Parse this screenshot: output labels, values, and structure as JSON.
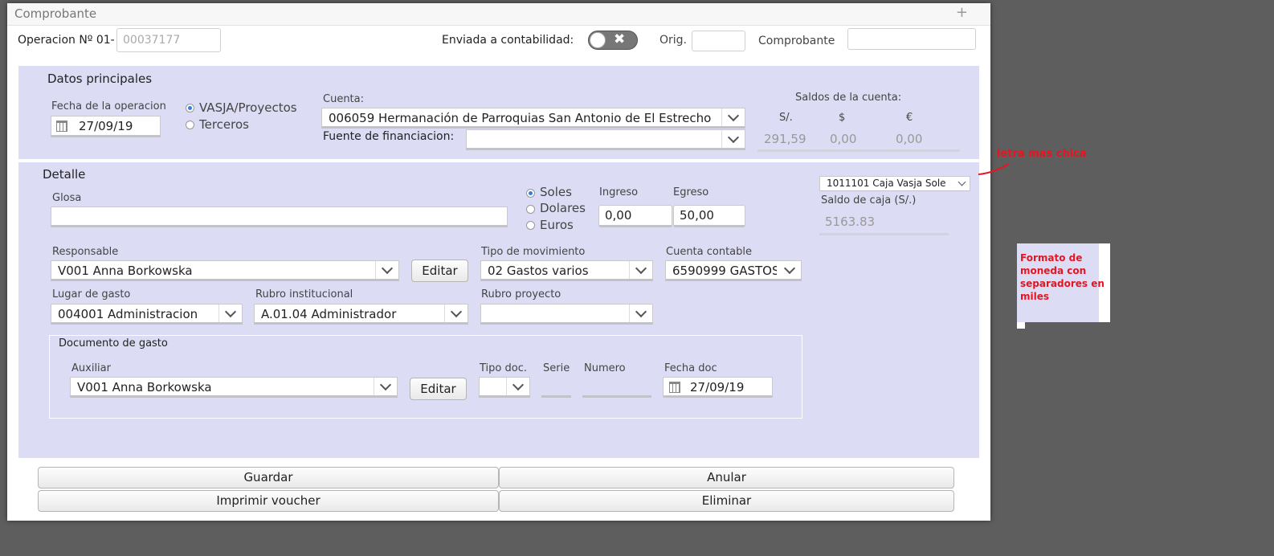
{
  "dialog": {
    "title": "Comprobante",
    "close_symbol": "+"
  },
  "header": {
    "operacion_label": "Operacion Nº 01-",
    "operacion_value": "00037177",
    "enviada_label": "Enviada a contabilidad:",
    "orig_label": "Orig.",
    "comprobante_label": "Comprobante"
  },
  "principales": {
    "section_title": "Datos principales",
    "fecha_label": "Fecha de la operacion",
    "fecha_value": "27/09/19",
    "radio_vasja": "VASJA/Proyectos",
    "radio_terceros": "Terceros",
    "cuenta_label": "Cuenta:",
    "cuenta_value": "006059 Hermanación de Parroquias San Antonio de El Estrecho",
    "fuente_label": "Fuente de financiacion:",
    "fuente_value": "",
    "saldos_title": "Saldos de la cuenta:",
    "saldo_soles_label": "S/.",
    "saldo_dolar_label": "$",
    "saldo_euro_label": "€",
    "saldo_soles": "291,59",
    "saldo_dolar": "0,00",
    "saldo_euro": "0,00"
  },
  "detalle": {
    "section_title": "Detalle",
    "glosa_label": "Glosa",
    "glosa_value": "",
    "moneda_soles": "Soles",
    "moneda_dolares": "Dolares",
    "moneda_euros": "Euros",
    "ingreso_label": "Ingreso",
    "ingreso_value": "0,00",
    "egreso_label": "Egreso",
    "egreso_value": "50,00",
    "caja_value": "1011101 Caja Vasja Soles",
    "saldo_caja_label": "Saldo de caja (S/.)",
    "saldo_caja_value": "5163.83",
    "responsable_label": "Responsable",
    "responsable_value": "V001 Anna Borkowska",
    "editar_label": "Editar",
    "tipo_mov_label": "Tipo de movimiento",
    "tipo_mov_value": "02 Gastos varios",
    "cuenta_contable_label": "Cuenta contable",
    "cuenta_contable_value": "6590999 GASTOS",
    "lugar_label": "Lugar de gasto",
    "lugar_value": "004001 Administracion",
    "rubro_inst_label": "Rubro institucional",
    "rubro_inst_value": "A.01.04 Administrador",
    "rubro_proy_label": "Rubro proyecto",
    "rubro_proy_value": ""
  },
  "documento": {
    "section_title": "Documento de gasto",
    "auxiliar_label": "Auxiliar",
    "auxiliar_value": "V001 Anna Borkowska",
    "editar_label": "Editar",
    "tipo_doc_label": "Tipo doc.",
    "serie_label": "Serie",
    "numero_label": "Numero",
    "fecha_doc_label": "Fecha doc",
    "fecha_doc_value": "27/09/19"
  },
  "actions": {
    "guardar": "Guardar",
    "anular": "Anular",
    "imprimir": "Imprimir voucher",
    "eliminar": "Eliminar"
  },
  "annotations": {
    "note_small_font": "letra mas chica",
    "note_currency": "Formato de moneda con separadores en miles",
    "annotation_color": "#e8141f"
  }
}
